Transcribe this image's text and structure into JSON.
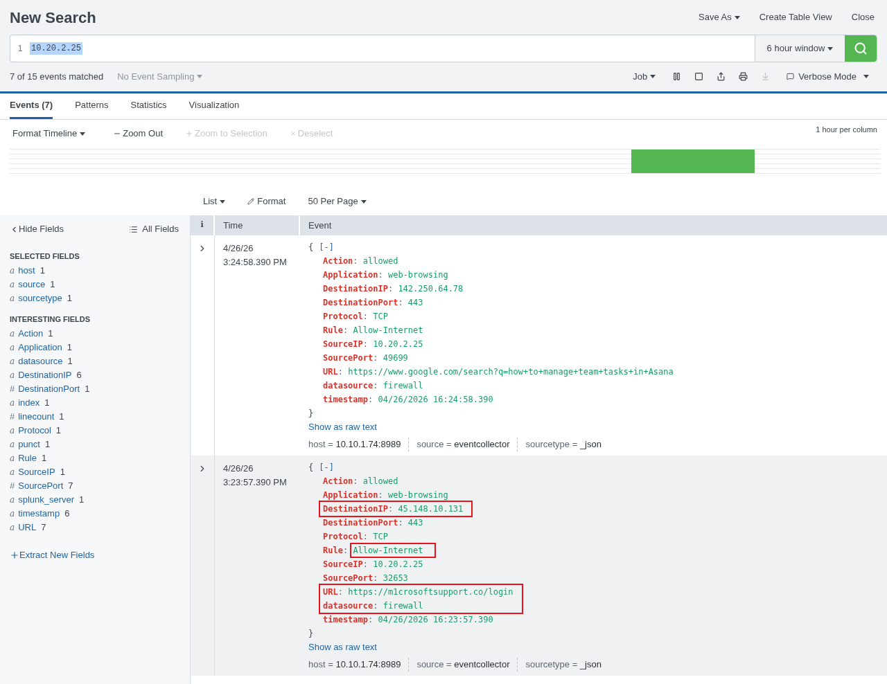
{
  "header": {
    "title": "New Search",
    "actions": [
      {
        "label": "Save As",
        "dropdown": true
      },
      {
        "label": "Create Table View",
        "dropdown": false
      },
      {
        "label": "Close",
        "dropdown": false
      }
    ]
  },
  "search": {
    "line_number": "1",
    "query": "10.20.2.25",
    "query_selected": true,
    "time_range": "6 hour window"
  },
  "status": {
    "matched": "7 of 15 events matched",
    "sampling": "No Event Sampling",
    "job": "Job",
    "mode": "Verbose Mode",
    "download_disabled": true
  },
  "tabs": [
    {
      "label": "Events (7)",
      "selected": true
    },
    {
      "label": "Patterns",
      "selected": false
    },
    {
      "label": "Statistics",
      "selected": false
    },
    {
      "label": "Visualization",
      "selected": false
    }
  ],
  "timeline": {
    "format": "Format Timeline",
    "zoom_out": "Zoom Out",
    "zoom_selection": "Zoom to Selection",
    "deselect": "Deselect",
    "scale": "1 hour per column"
  },
  "results_toolbar": {
    "view": "List",
    "format": "Format",
    "per_page": "50 Per Page"
  },
  "sidebar": {
    "hide": "Hide Fields",
    "all": "All Fields",
    "sections": [
      {
        "title": "SELECTED FIELDS",
        "fields": [
          {
            "type": "a",
            "name": "host",
            "count": "1"
          },
          {
            "type": "a",
            "name": "source",
            "count": "1"
          },
          {
            "type": "a",
            "name": "sourcetype",
            "count": "1"
          }
        ]
      },
      {
        "title": "INTERESTING FIELDS",
        "fields": [
          {
            "type": "a",
            "name": "Action",
            "count": "1"
          },
          {
            "type": "a",
            "name": "Application",
            "count": "1"
          },
          {
            "type": "a",
            "name": "datasource",
            "count": "1"
          },
          {
            "type": "a",
            "name": "DestinationIP",
            "count": "6"
          },
          {
            "type": "#",
            "name": "DestinationPort",
            "count": "1"
          },
          {
            "type": "a",
            "name": "index",
            "count": "1"
          },
          {
            "type": "#",
            "name": "linecount",
            "count": "1"
          },
          {
            "type": "a",
            "name": "Protocol",
            "count": "1"
          },
          {
            "type": "a",
            "name": "punct",
            "count": "1"
          },
          {
            "type": "a",
            "name": "Rule",
            "count": "1"
          },
          {
            "type": "a",
            "name": "SourceIP",
            "count": "1"
          },
          {
            "type": "#",
            "name": "SourcePort",
            "count": "7"
          },
          {
            "type": "a",
            "name": "splunk_server",
            "count": "1"
          },
          {
            "type": "a",
            "name": "timestamp",
            "count": "6"
          },
          {
            "type": "a",
            "name": "URL",
            "count": "7"
          }
        ]
      }
    ],
    "extract": "Extract New Fields"
  },
  "table": {
    "columns": [
      "i",
      "Time",
      "Event"
    ],
    "rows": [
      {
        "date": "4/26/26",
        "time": "3:24:58.390 PM",
        "open": "{",
        "collapse": "[-]",
        "close": "}",
        "raw_link": "Show as raw text",
        "fields": [
          {
            "key": "Action",
            "sep": ":",
            "value": "allowed",
            "boxed": false,
            "value_boxed": false
          },
          {
            "key": "Application",
            "sep": ":",
            "value": "web-browsing",
            "boxed": false,
            "value_boxed": false
          },
          {
            "key": "DestinationIP",
            "sep": ":",
            "value": "142.250.64.78",
            "boxed": false,
            "value_boxed": false
          },
          {
            "key": "DestinationPort",
            "sep": ":",
            "value": "443",
            "boxed": false,
            "value_boxed": false
          },
          {
            "key": "Protocol",
            "sep": ":",
            "value": "TCP",
            "boxed": false,
            "value_boxed": false
          },
          {
            "key": "Rule",
            "sep": ":",
            "value": "Allow-Internet",
            "boxed": false,
            "value_boxed": false
          },
          {
            "key": "SourceIP",
            "sep": ":",
            "value": "10.20.2.25",
            "boxed": false,
            "value_boxed": false
          },
          {
            "key": "SourcePort",
            "sep": ":",
            "value": "49699",
            "boxed": false,
            "value_boxed": false
          },
          {
            "key": "URL",
            "sep": ":",
            "value": "https://www.google.com/search?q=how+to+manage+team+tasks+in+Asana",
            "boxed": false,
            "value_boxed": false
          },
          {
            "key": "datasource",
            "sep": ":",
            "value": "firewall",
            "boxed": false,
            "value_boxed": false
          },
          {
            "key": "timestamp",
            "sep": ":",
            "value": "04/26/2026 16:24:58.390",
            "boxed": false,
            "value_boxed": false
          }
        ],
        "meta": [
          {
            "key": "host =",
            "value": "10.10.1.74:8989"
          },
          {
            "key": "source =",
            "value": "eventcollector"
          },
          {
            "key": "sourcetype =",
            "value": "_json"
          }
        ]
      },
      {
        "date": "4/26/26",
        "time": "3:23:57.390 PM",
        "open": "{",
        "collapse": "[-]",
        "close": "}",
        "raw_link": "Show as raw text",
        "fields": [
          {
            "key": "Action",
            "sep": ":",
            "value": "allowed",
            "boxed": false,
            "value_boxed": false
          },
          {
            "key": "Application",
            "sep": ":",
            "value": "web-browsing",
            "boxed": false,
            "value_boxed": false
          },
          {
            "key": "DestinationIP",
            "sep": ":",
            "value": "45.148.10.131",
            "boxed": true,
            "value_boxed": false
          },
          {
            "key": "DestinationPort",
            "sep": ":",
            "value": "443",
            "boxed": false,
            "value_boxed": false
          },
          {
            "key": "Protocol",
            "sep": ":",
            "value": "TCP",
            "boxed": false,
            "value_boxed": false
          },
          {
            "key": "Rule",
            "sep": ":",
            "value": "Allow-Internet",
            "boxed": false,
            "value_boxed": true
          },
          {
            "key": "SourceIP",
            "sep": ":",
            "value": "10.20.2.25",
            "boxed": false,
            "value_boxed": false
          },
          {
            "key": "SourcePort",
            "sep": ":",
            "value": "32653",
            "boxed": false,
            "value_boxed": false
          },
          {
            "key": "URL",
            "sep": ":",
            "value": "https://m1crosoftsupport.co/login",
            "boxed": true,
            "value_boxed": false
          },
          {
            "key": "datasource",
            "sep": ":",
            "value": "firewall",
            "boxed": true,
            "value_boxed": false
          },
          {
            "key": "timestamp",
            "sep": ":",
            "value": "04/26/2026 16:23:57.390",
            "boxed": false,
            "value_boxed": false
          }
        ],
        "meta": [
          {
            "key": "host =",
            "value": "10.10.1.74:8989"
          },
          {
            "key": "source =",
            "value": "eventcollector"
          },
          {
            "key": "sourcetype =",
            "value": "_json"
          }
        ]
      }
    ]
  }
}
